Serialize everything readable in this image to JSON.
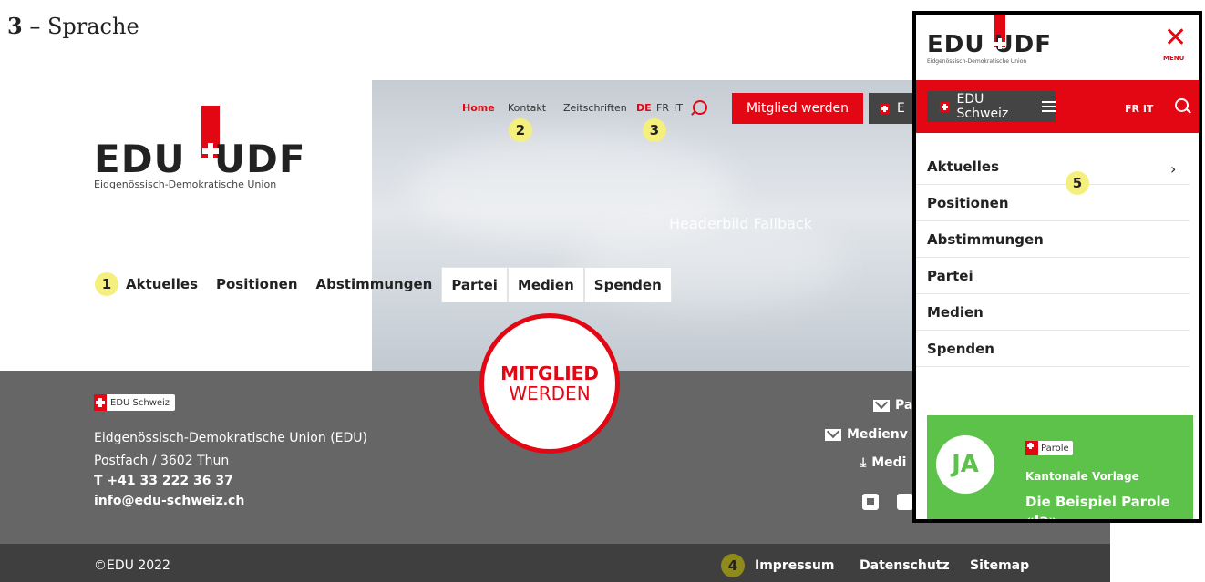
{
  "caption": {
    "number": "3",
    "rest": " – Sprache"
  },
  "logo": {
    "text": "EDU  UDF",
    "subtitle": "Eidgenössisch-Demokratische Union"
  },
  "hero": {
    "label": "Headerbild Fallback"
  },
  "topnav": {
    "home": "Home",
    "kontakt": "Kontakt",
    "zeitschriften": "Zeitschriften",
    "lang_de": "DE",
    "lang_fr": "FR",
    "lang_it": "IT",
    "mitglied_button": "Mitglied werden",
    "edu_button": "E"
  },
  "markers": [
    "1",
    "2",
    "3",
    "4",
    "5"
  ],
  "mainnav": [
    "Aktuelles",
    "Positionen",
    "Abstimmungen",
    "Partei",
    "Medien",
    "Spenden"
  ],
  "circle": {
    "line1": "MITGLIED",
    "line2": "WERDEN"
  },
  "footer": {
    "badge": "EDU Schweiz",
    "org": "Eidgenössisch-Demokratische Union (EDU)",
    "address": "Postfach / 3602 Thun",
    "tel": "T +41 33 222 36 37",
    "email": "info@edu-schweiz.ch",
    "right_links": [
      "Pa",
      "Medienv",
      "Medi"
    ],
    "copyright": "©EDU 2022",
    "bottom_links": [
      "Impressum",
      "Datenschutz",
      "Sitemap"
    ]
  },
  "mobile": {
    "logo": "EDU UDF",
    "logo_sub": "Eidgenössisch-Demokratische Union",
    "close": "✕",
    "menu_label": "MENU",
    "edu_button": "EDU Schweiz",
    "lang": "FR  IT",
    "items": [
      "Aktuelles",
      "Positionen",
      "Abstimmungen",
      "Partei",
      "Medien",
      "Spenden"
    ],
    "card": {
      "ja": "JA",
      "badge": "Parole",
      "kind": "Kantonale Vorlage",
      "title": "Die Beispiel Parole",
      "title2": "«Ja»"
    }
  },
  "colors": {
    "brand_red": "#e30613",
    "footer": "#666666",
    "footer_bottom": "#3f3f3f",
    "card_green": "#5cc24a",
    "marker": "#f5ef7e"
  }
}
